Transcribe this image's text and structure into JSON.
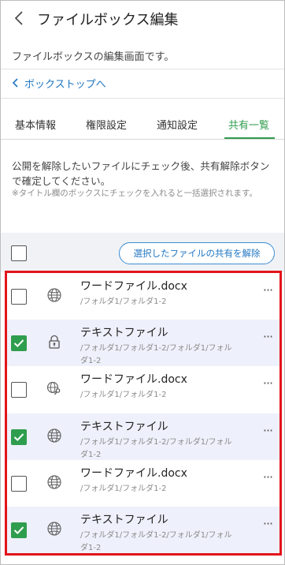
{
  "header": {
    "title": "ファイルボックス編集"
  },
  "description": "ファイルボックスの編集画面です。",
  "breadcrumb": {
    "label": "ボックストップへ"
  },
  "tabs": [
    {
      "label": "基本情報",
      "active": false
    },
    {
      "label": "権限設定",
      "active": false
    },
    {
      "label": "通知設定",
      "active": false
    },
    {
      "label": "共有一覧",
      "active": true
    }
  ],
  "instruction": "公開を解除したいファイルにチェック後、共有解除ボタンで確定してください。",
  "note": "※タイトル欄のボックスにチェックを入れると一括選択されます。",
  "toolbar": {
    "select_all_checked": false,
    "unshare_button_label": "選択したファイルの共有を解除"
  },
  "files": [
    {
      "name": "ワードファイル.docx",
      "path": "/フォルダ1/フォルダ1-2",
      "icon": "globe-icon",
      "checked": false
    },
    {
      "name": "テキストファイル",
      "path": "/フォルダ1/フォルダ1-2/フォルダ1/フォルダ1-2",
      "icon": "lock-icon",
      "checked": true
    },
    {
      "name": "ワードファイル.docx",
      "path": "/フォルダ1/フォルダ1-2",
      "icon": "globe-key-icon",
      "checked": false
    },
    {
      "name": "テキストファイル",
      "path": "/フォルダ1/フォルダ1-2/フォルダ1/フォルダ1-2",
      "icon": "globe-icon",
      "checked": true
    },
    {
      "name": "ワードファイル.docx",
      "path": "/フォルダ1/フォルダ1-2",
      "icon": "globe-icon",
      "checked": false
    },
    {
      "name": "テキストファイル",
      "path": "/フォルダ1/フォルダ1-2/フォルダ1/フォルダ1-2",
      "icon": "globe-icon",
      "checked": true
    }
  ],
  "more_menu_glyph": "···",
  "colors": {
    "accent_green": "#2f9d4e",
    "link_blue": "#1f76c2",
    "highlight_red": "#e3141b",
    "row_alt_bg": "#eef0fb"
  }
}
